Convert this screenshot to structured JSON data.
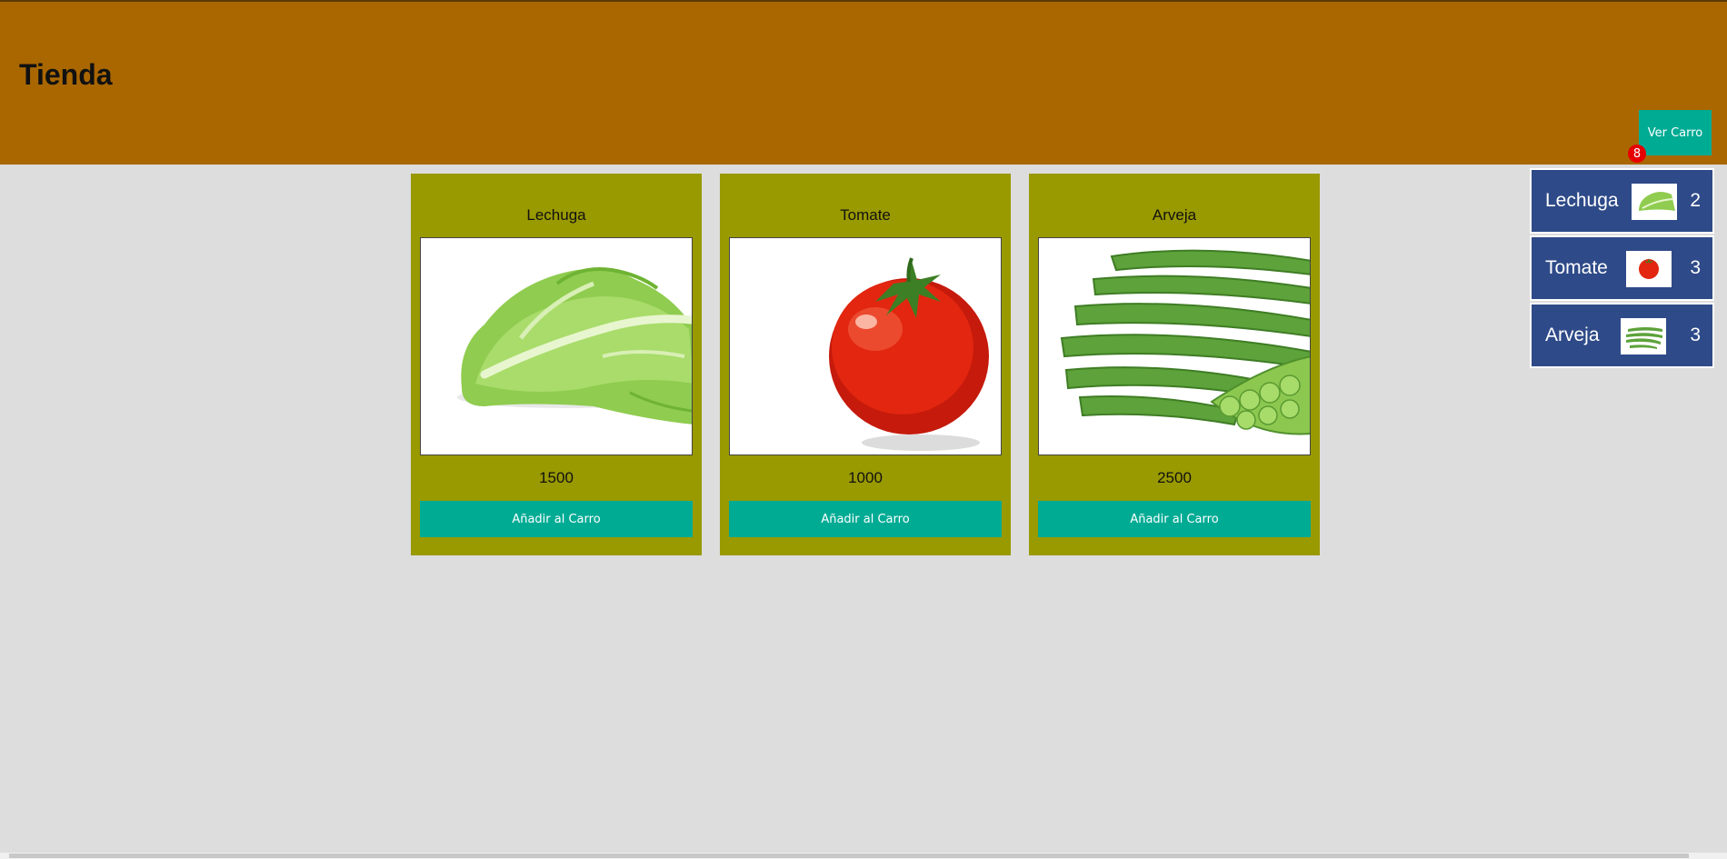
{
  "header": {
    "title": "Tienda"
  },
  "cart": {
    "button_label": "Ver Carro",
    "count": "8"
  },
  "products": [
    {
      "name": "Lechuga",
      "price": "1500",
      "button_label": "Añadir al Carro",
      "image": "lettuce"
    },
    {
      "name": "Tomate",
      "price": "1000",
      "button_label": "Añadir al Carro",
      "image": "tomato"
    },
    {
      "name": "Arveja",
      "price": "2500",
      "button_label": "Añadir al Carro",
      "image": "peas"
    }
  ],
  "cart_items": [
    {
      "name": "Lechuga",
      "qty": "2",
      "image": "lettuce"
    },
    {
      "name": "Tomate",
      "qty": "3",
      "image": "tomato"
    },
    {
      "name": "Arveja",
      "qty": "3",
      "image": "peas"
    }
  ],
  "colors": {
    "header": "#aa6700",
    "card": "#999900",
    "button": "#00ab94",
    "cart_item": "#2e4a88",
    "badge": "#e60000",
    "background": "#dddddd"
  }
}
